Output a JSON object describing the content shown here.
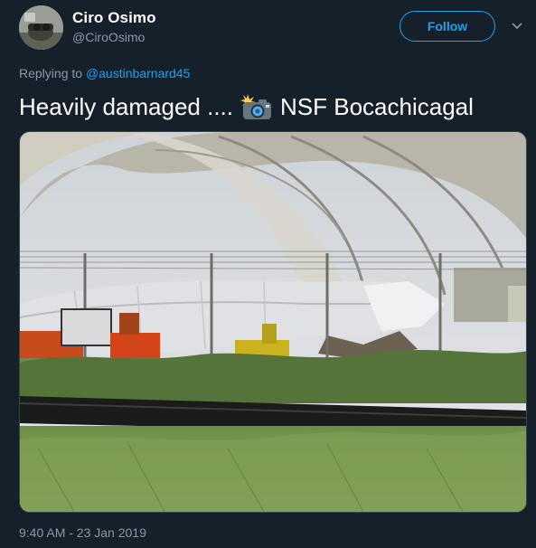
{
  "user": {
    "name": "Ciro Osimo",
    "handle": "@CiroOsimo"
  },
  "follow_label": "Follow",
  "reply": {
    "prefix": "Replying to",
    "mention": "@austinbarnard45"
  },
  "tweet": {
    "text_before": "Heavily damaged ....",
    "text_after": "NSF Bocachicagal",
    "emoji_icon": "camera-with-flash-icon"
  },
  "timestamp": "9:40 AM - 23 Jan 2019",
  "colors": {
    "background": "#15202b",
    "accent": "#1da1f2",
    "secondary_text": "#8899a6"
  }
}
